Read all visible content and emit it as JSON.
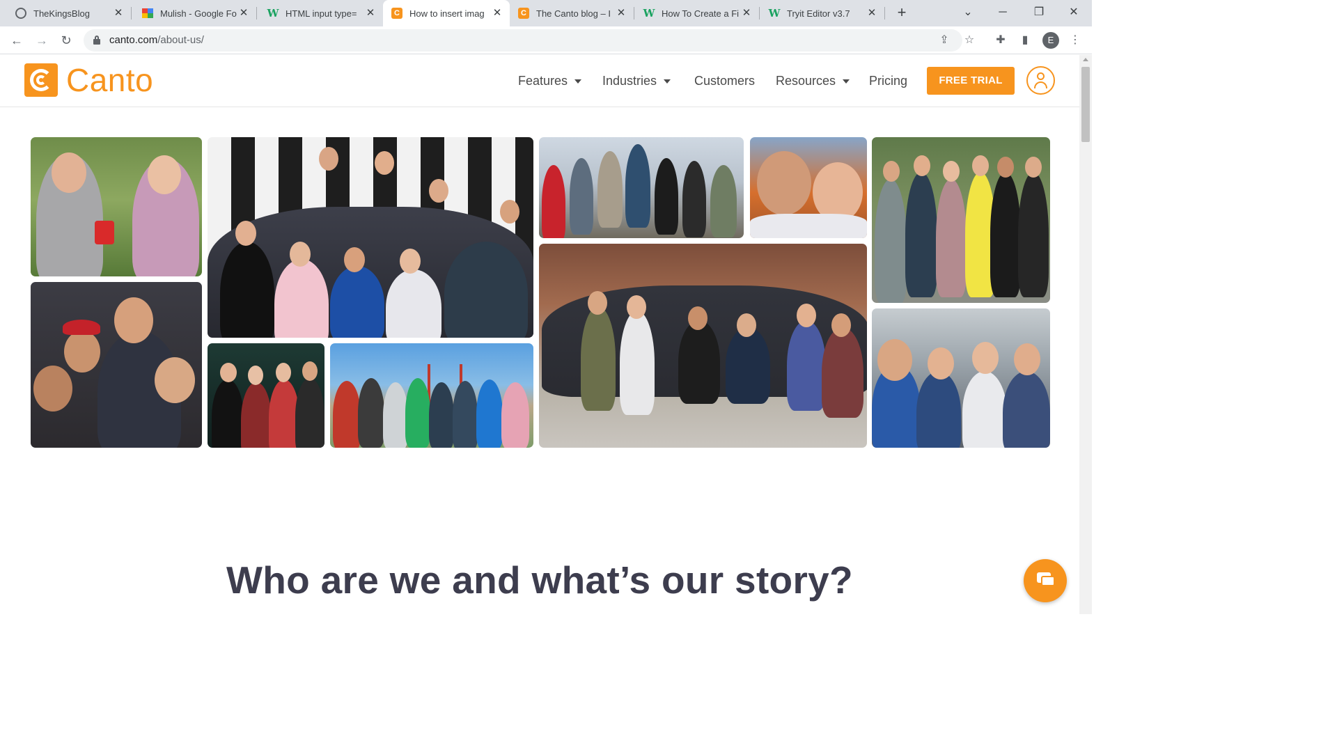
{
  "browser": {
    "tabs": [
      {
        "title": "TheKingsBlog",
        "favicon": "globe-icon",
        "active": false
      },
      {
        "title": "Mulish - Google Fo",
        "favicon": "google-fonts-icon",
        "active": false
      },
      {
        "title": "HTML input type=",
        "favicon": "w3schools-icon",
        "active": false
      },
      {
        "title": "How to insert imag",
        "favicon": "canto-icon",
        "active": true
      },
      {
        "title": "The Canto blog – I",
        "favicon": "canto-icon",
        "active": false
      },
      {
        "title": "How To Create a Fi",
        "favicon": "w3schools-icon",
        "active": false
      },
      {
        "title": "Tryit Editor v3.7",
        "favicon": "w3schools-icon",
        "active": false
      }
    ],
    "url_host": "canto.com",
    "url_path": "/about-us/",
    "profile_initial": "E"
  },
  "site": {
    "logo_text": "Canto",
    "nav": {
      "features": "Features",
      "industries": "Industries",
      "customers": "Customers",
      "resources": "Resources",
      "pricing": "Pricing"
    },
    "cta": "FREE TRIAL",
    "headline": "Who are we and what’s our story?"
  },
  "colors": {
    "brand_orange": "#f7941e",
    "heading": "#3d3d4e",
    "nav_text": "#4a4a4a"
  }
}
